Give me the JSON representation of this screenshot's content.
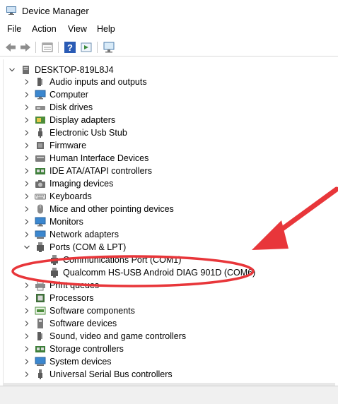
{
  "window": {
    "title": "Device Manager"
  },
  "menu": {
    "file": "File",
    "action": "Action",
    "view": "View",
    "help": "Help"
  },
  "root": {
    "label": "DESKTOP-819L8J4"
  },
  "categories": [
    "Audio inputs and outputs",
    "Computer",
    "Disk drives",
    "Display adapters",
    "Electronic Usb Stub",
    "Firmware",
    "Human Interface Devices",
    "IDE ATA/ATAPI controllers",
    "Imaging devices",
    "Keyboards",
    "Mice and other pointing devices",
    "Monitors",
    "Network adapters",
    "Ports (COM & LPT)"
  ],
  "ports_children": [
    "Communications Port (COM1)",
    "Qualcomm HS-USB Android DIAG 901D (COM6)"
  ],
  "categories_after": [
    "Print queues",
    "Processors",
    "Software components",
    "Software devices",
    "Sound, video and game controllers",
    "Storage controllers",
    "System devices",
    "Universal Serial Bus controllers"
  ],
  "colors": {
    "annotation": "#e8363a"
  }
}
